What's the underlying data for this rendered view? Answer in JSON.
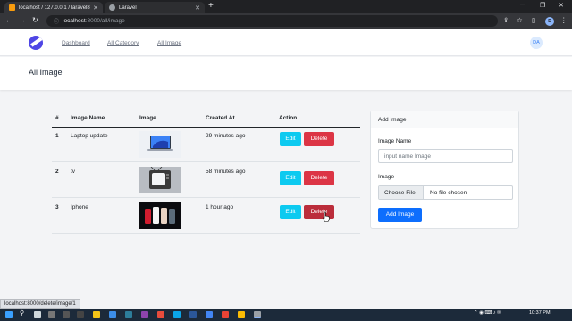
{
  "browser": {
    "tabs": [
      {
        "title": "localhost / 127.0.0.1 / laravel8 / i",
        "favicon_color": "#f89c0e"
      },
      {
        "title": "Laravel",
        "favicon_color": "#9aa0a6"
      }
    ],
    "new_tab": "+",
    "address_host": "localhost",
    "address_path": ":8000/all/image",
    "profile_initial": "D"
  },
  "nav": {
    "links": [
      "Dashboard",
      "All Category",
      "All Image"
    ],
    "avatar": "DA"
  },
  "page_title": "All Image",
  "table": {
    "headers": [
      "#",
      "Image Name",
      "Image",
      "Created At",
      "Action"
    ],
    "rows": [
      {
        "num": "1",
        "name": "Laptop update",
        "created": "29 minutes ago",
        "thumb": "laptop"
      },
      {
        "num": "2",
        "name": "tv",
        "created": "58 minutes ago",
        "thumb": "tv"
      },
      {
        "num": "3",
        "name": "Iphone",
        "created": "1 hour ago",
        "thumb": "phones"
      }
    ],
    "edit_label": "Edit",
    "delete_label": "Delete"
  },
  "form": {
    "title": "Add Image",
    "name_label": "Image Name",
    "name_placeholder": "input name Image",
    "image_label": "Image",
    "choose_label": "Choose File",
    "file_status": "No file chosen",
    "submit_label": "Add Image"
  },
  "status_url": "localhost:8000/delete/image/1",
  "taskbar": {
    "clock": "10:37 PM"
  },
  "colors": {
    "primary": "#0d6efd",
    "info": "#0dcaf0",
    "danger": "#dc3545",
    "logo": "#4f46e5"
  }
}
